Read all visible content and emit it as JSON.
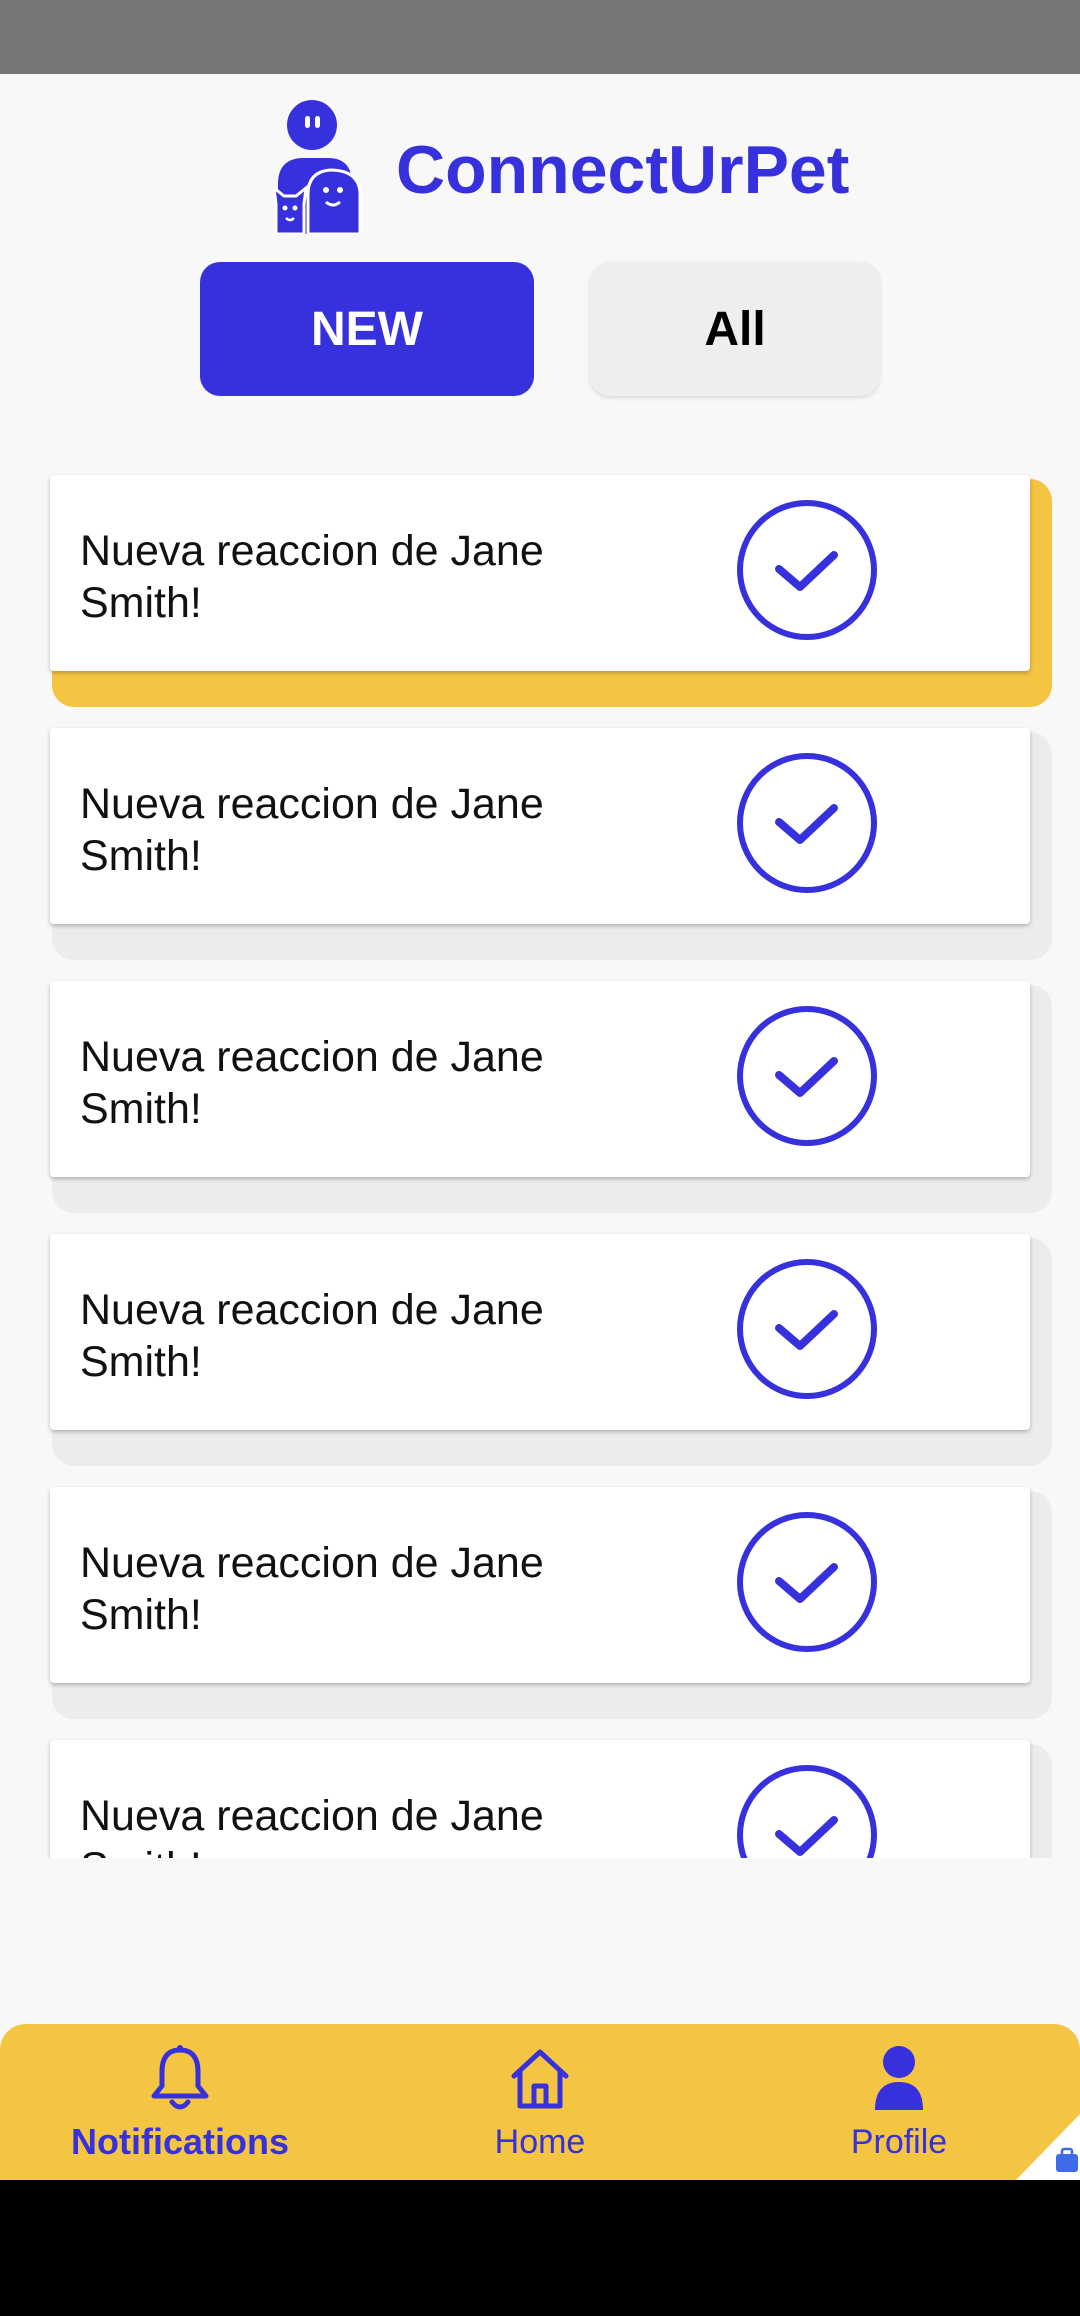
{
  "app": {
    "title": "ConnectUrPet"
  },
  "filters": {
    "new_label": "NEW",
    "all_label": "All",
    "selected": "NEW"
  },
  "notifications": [
    {
      "line1": "Nueva reaccion de Jane",
      "line2": "Smith!",
      "highlighted": true
    },
    {
      "line1": "Nueva reaccion de Jane",
      "line2": "Smith!",
      "highlighted": false
    },
    {
      "line1": "Nueva reaccion de Jane",
      "line2": "Smith!",
      "highlighted": false
    },
    {
      "line1": "Nueva reaccion de Jane",
      "line2": "Smith!",
      "highlighted": false
    },
    {
      "line1": "Nueva reaccion de Jane",
      "line2": "Smith!",
      "highlighted": false
    },
    {
      "line1": "Nueva reaccion de Jane",
      "line2": "Smith!",
      "highlighted": false
    }
  ],
  "bottom_nav": {
    "items": [
      {
        "label": "Notifications",
        "icon": "bell-icon",
        "active": true
      },
      {
        "label": "Home",
        "icon": "home-icon",
        "active": false
      },
      {
        "label": "Profile",
        "icon": "person-icon",
        "active": false
      }
    ]
  },
  "colors": {
    "primary": "#3730dd",
    "accent": "#f4c443",
    "card_back": "#ececec",
    "background": "#f8f8f8",
    "status_bar": "#777777"
  }
}
